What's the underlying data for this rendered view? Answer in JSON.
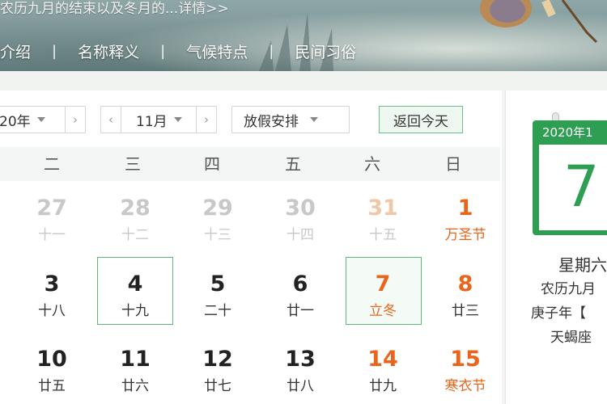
{
  "banner": {
    "text": "农历九月的结束以及冬月的...详情>>"
  },
  "nav": {
    "items": [
      "介绍",
      "名称释义",
      "气候特点",
      "民间习俗"
    ]
  },
  "controls": {
    "year": "20年",
    "month": "11月",
    "holiday": "放假安排",
    "today_button": "返回今天",
    "prev_arrow": "‹",
    "next_arrow": "›"
  },
  "weekdays": [
    "二",
    "三",
    "四",
    "五",
    "六",
    "日"
  ],
  "weeks": [
    [
      {
        "day": "27",
        "lunar": "十一",
        "style": "muted"
      },
      {
        "day": "28",
        "lunar": "十二",
        "style": "muted"
      },
      {
        "day": "29",
        "lunar": "十三",
        "style": "muted"
      },
      {
        "day": "30",
        "lunar": "十四",
        "style": "muted"
      },
      {
        "day": "31",
        "lunar": "十五",
        "style": "muted-orange"
      },
      {
        "day": "1",
        "lunar": "万圣节",
        "style": "orange"
      }
    ],
    [
      {
        "day": "3",
        "lunar": "十八",
        "style": "normal"
      },
      {
        "day": "4",
        "lunar": "十九",
        "style": "normal",
        "boxed": true
      },
      {
        "day": "5",
        "lunar": "二十",
        "style": "normal"
      },
      {
        "day": "6",
        "lunar": "廿一",
        "style": "normal"
      },
      {
        "day": "7",
        "lunar": "立冬",
        "style": "orange",
        "boxed": true,
        "today": true
      },
      {
        "day": "8",
        "lunar": "廿三",
        "style": "orange-num"
      }
    ],
    [
      {
        "day": "10",
        "lunar": "廿五",
        "style": "normal"
      },
      {
        "day": "11",
        "lunar": "廿六",
        "style": "normal"
      },
      {
        "day": "12",
        "lunar": "廿七",
        "style": "normal"
      },
      {
        "day": "13",
        "lunar": "廿八",
        "style": "normal"
      },
      {
        "day": "14",
        "lunar": "廿九",
        "style": "orange-num"
      },
      {
        "day": "15",
        "lunar": "寒衣节",
        "style": "orange"
      }
    ]
  ],
  "side_panel": {
    "card_header": "2020年1",
    "card_day": "7",
    "weekday": "星期六",
    "lunar_date": "农历九月",
    "ganzhi": "庚子年【",
    "extra": "天蝎座"
  },
  "colors": {
    "accent_green": "#2e9e52",
    "holiday_orange": "#e8651b",
    "muted_gray": "#c8c8c8"
  }
}
